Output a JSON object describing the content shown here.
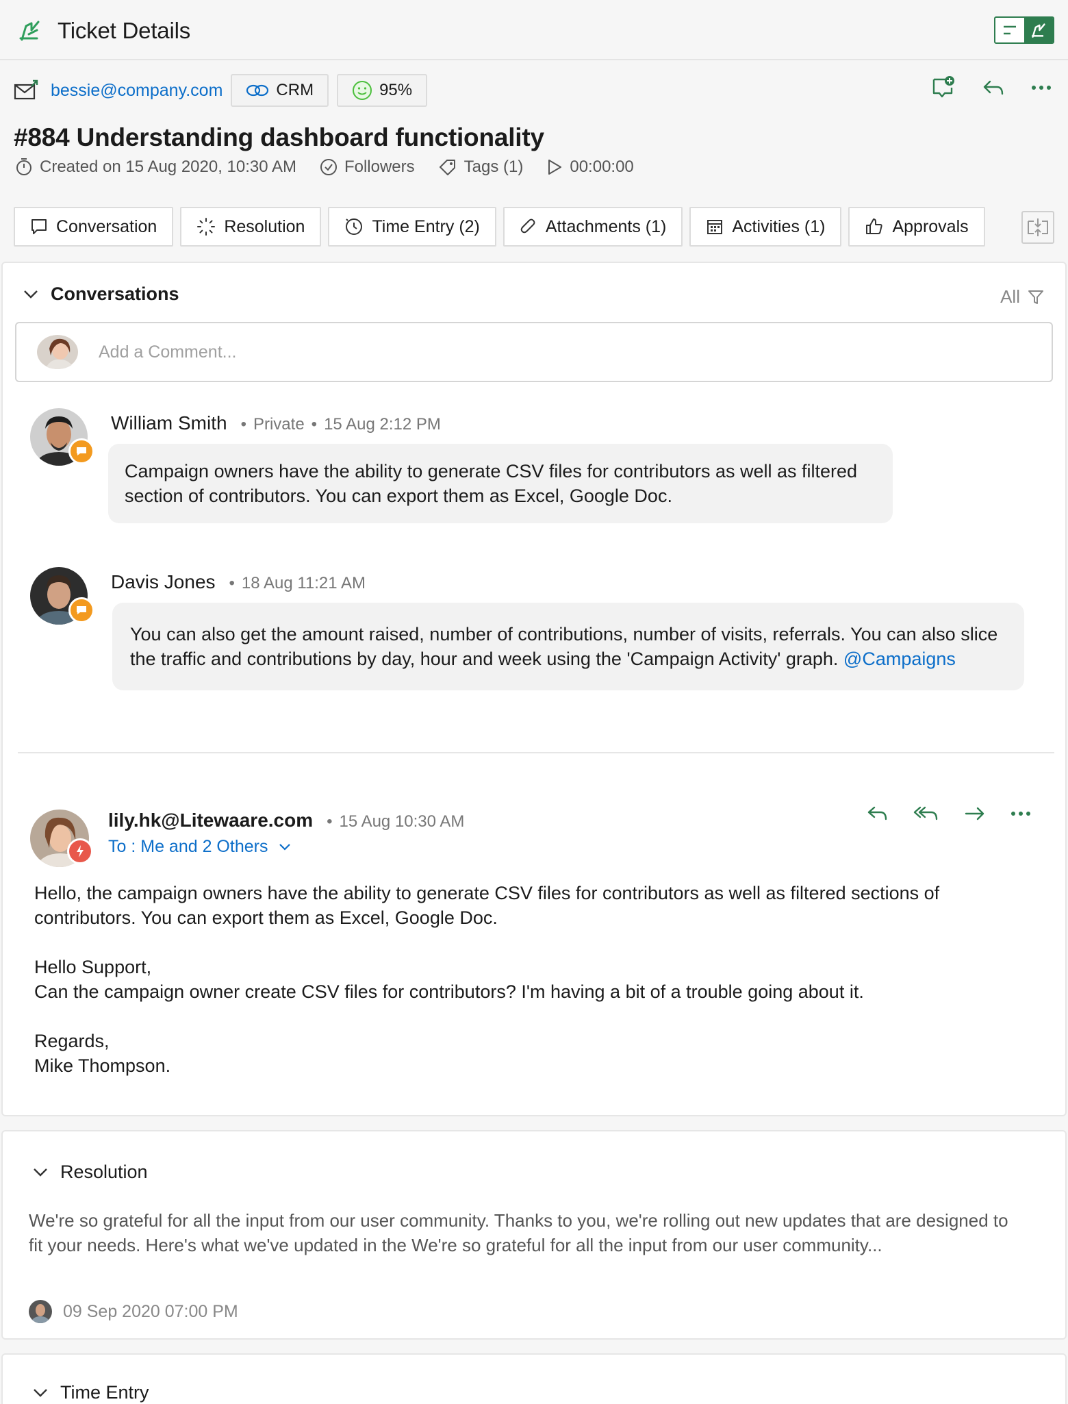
{
  "header": {
    "title": "Ticket Details",
    "logo_icon": "support-logo-icon",
    "accent": "#2e7d4f"
  },
  "contact": {
    "email": "bessie@company.com",
    "crm_label": "CRM",
    "sentiment": "95%"
  },
  "ticket": {
    "title": "#884 Understanding dashboard functionality",
    "created": "Created on 15 Aug 2020, 10:30 AM",
    "followers": "Followers",
    "tags": "Tags (1)",
    "timer": "00:00:00"
  },
  "tabs": [
    {
      "label": "Conversation",
      "icon": "chat-icon"
    },
    {
      "label": "Resolution",
      "icon": "loading-icon"
    },
    {
      "label": "Time Entry (2)",
      "icon": "clock-icon"
    },
    {
      "label": "Attachments (1)",
      "icon": "paperclip-icon"
    },
    {
      "label": "Activities (1)",
      "icon": "calendar-icon"
    },
    {
      "label": "Approvals",
      "icon": "thumbs-up-icon"
    }
  ],
  "conversations": {
    "heading": "Conversations",
    "filter_label": "All",
    "comment_placeholder": "Add a Comment...",
    "comments": [
      {
        "author": "William Smith",
        "visibility": "Private",
        "time": "15 Aug 2:12 PM",
        "text": "Campaign owners have the ability to generate CSV files for contributors as well as filtered section of contributors. You can export them as Excel, Google Doc."
      },
      {
        "author": "Davis Jones",
        "time": "18 Aug 11:21 AM",
        "text": "You can also get the amount raised, number of contributions, number of visits, referrals. You can also slice the traffic and contributions by day, hour and week using the 'Campaign Activity' graph. ",
        "mention": "@Campaigns"
      }
    ],
    "email": {
      "from": "lily.hk@Litewaare.com",
      "time": "15 Aug 10:30 AM",
      "to": "To : Me and 2 Others",
      "body": [
        "Hello, the campaign owners have the ability to generate CSV files for contributors as well as filtered sections of contributors. You can export them as Excel, Google Doc.",
        "Hello Support,",
        "Can the campaign owner create CSV files for contributors? I'm having a bit of a trouble going about it.",
        "Regards,",
        "Mike Thompson."
      ]
    }
  },
  "resolution": {
    "heading": "Resolution",
    "text": "We're so grateful for all the input from our user community. Thanks to you, we're rolling out new updates that are designed to fit your needs. Here's what we've updated in the We're so grateful for all the input from our user community...",
    "date": "09 Sep 2020 07:00 PM"
  },
  "time_entry": {
    "heading": "Time Entry"
  }
}
